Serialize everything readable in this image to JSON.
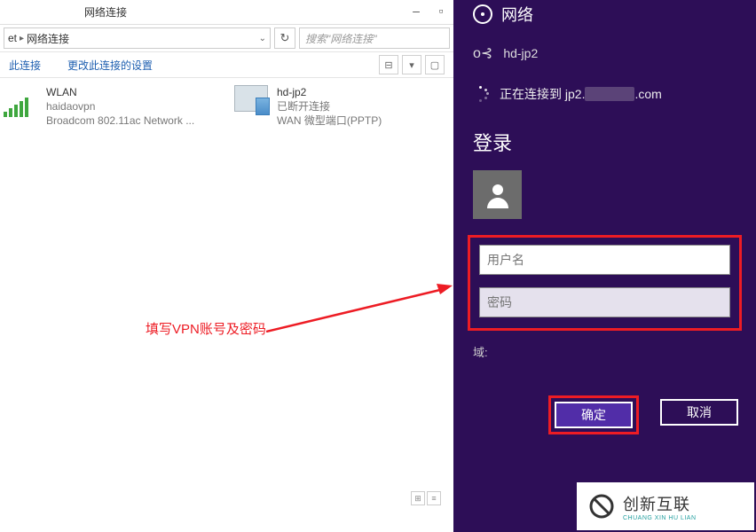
{
  "explorer": {
    "title": "网络连接",
    "breadcrumb": {
      "seg1": "et",
      "seg2": "网络连接"
    },
    "search_placeholder": "搜索\"网络连接\"",
    "toolbar": {
      "action1": "此连接",
      "action2": "更改此连接的设置"
    },
    "connections": [
      {
        "name": "WLAN",
        "sub1": "haidaovpn",
        "sub2": "Broadcom 802.11ac Network ..."
      },
      {
        "name": "hd-jp2",
        "sub1": "已断开连接",
        "sub2": "WAN 微型端口(PPTP)"
      }
    ]
  },
  "annotation": "填写VPN账号及密码",
  "charm": {
    "header": "网络",
    "current_conn": "hd-jp2",
    "connecting_prefix": "正在连接到 jp2.",
    "connecting_suffix": ".com",
    "login_title": "登录",
    "username_placeholder": "用户名",
    "password_placeholder": "密码",
    "domain_label": "域:",
    "ok": "确定",
    "cancel": "取消"
  },
  "watermark": {
    "main": "创新互联",
    "sub": "CHUANG XIN HU LIAN"
  }
}
